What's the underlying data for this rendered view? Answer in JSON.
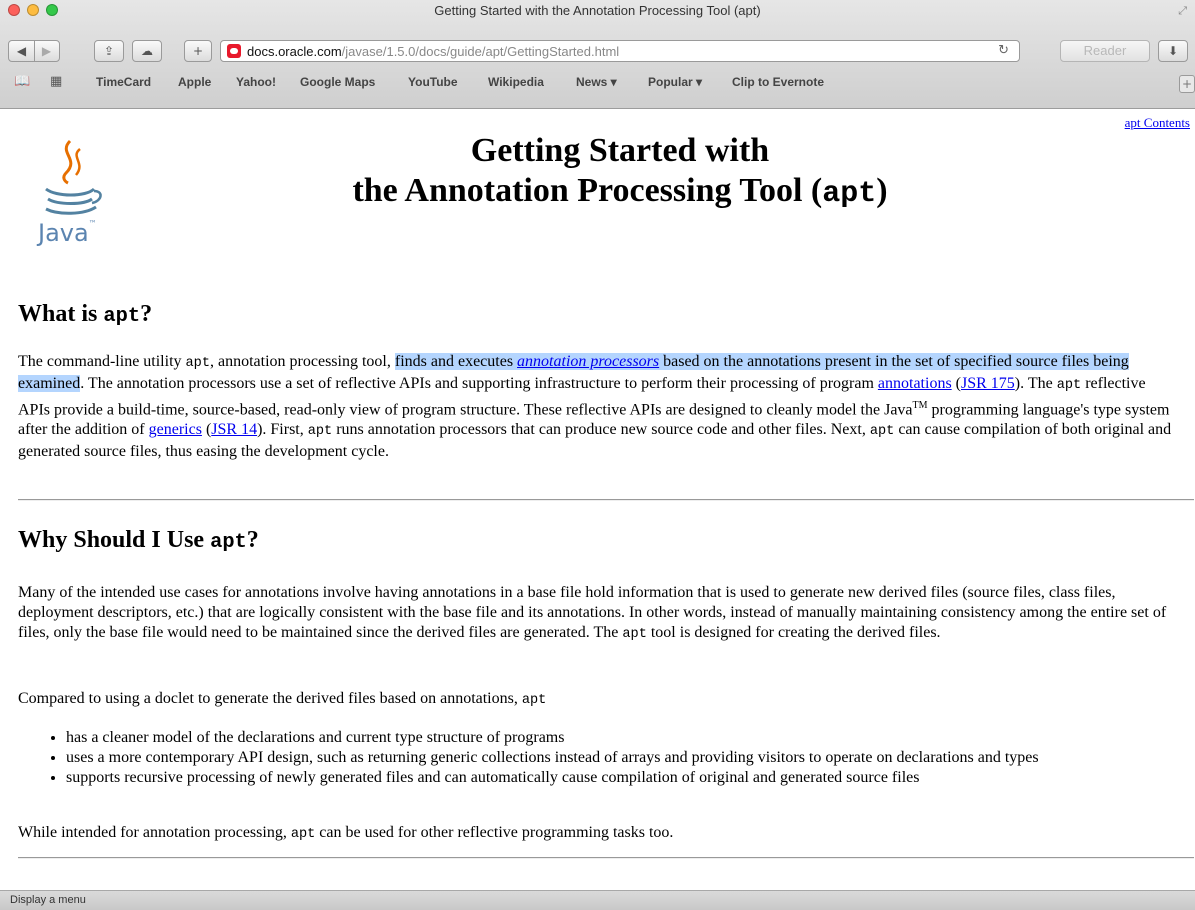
{
  "window": {
    "title": "Getting Started with the Annotation Processing Tool (apt)"
  },
  "toolbar": {
    "url_host": "docs.oracle.com",
    "url_path": "/javase/1.5.0/docs/guide/apt/GettingStarted.html",
    "reader_label": "Reader"
  },
  "bookmarks": [
    {
      "label": "TimeCard"
    },
    {
      "label": "Apple"
    },
    {
      "label": "Yahoo!"
    },
    {
      "label": "Google Maps"
    },
    {
      "label": "YouTube"
    },
    {
      "label": "Wikipedia"
    },
    {
      "label": "News ▾"
    },
    {
      "label": "Popular ▾"
    },
    {
      "label": "Clip to Evernote"
    }
  ],
  "page": {
    "top_link": "apt Contents",
    "logo_text": "Java",
    "logo_tm": "™",
    "title_line1": "Getting Started with",
    "title_line2": "the Annotation Processing Tool (",
    "title_code": "apt",
    "title_close": ")",
    "s1": {
      "heading_pre": "What is ",
      "heading_code": "apt",
      "heading_post": "?",
      "p_a": "The command-line utility ",
      "p_code1": "apt",
      "p_b": ", annotation processing tool, ",
      "p_hl1": "finds and executes ",
      "p_link1": "annotation processors",
      "p_hl2": " based on the annotations present in the set of specified source files being examined",
      "p_c": ". The annotation processors use a set of reflective APIs and supporting infrastructure to perform their processing of program ",
      "p_link2": "annotations",
      "p_d": " (",
      "p_link3": "JSR 175",
      "p_e": "). The ",
      "p_code2": "apt",
      "p_f": " reflective APIs provide a build-time, source-based, read-only view of program structure. These reflective APIs are designed to cleanly model the Java",
      "p_tm": "TM",
      "p_g": " programming language's type system after the addition of ",
      "p_link4": "generics",
      "p_h": " (",
      "p_link5": "JSR 14",
      "p_i": "). First, ",
      "p_code3": "apt",
      "p_j": " runs annotation processors that can produce new source code and other files. Next, ",
      "p_code4": "apt",
      "p_k": " can cause compilation of both original and generated source files, thus easing the development cycle."
    },
    "s2": {
      "heading_pre": "Why Should I Use ",
      "heading_code": "apt",
      "heading_post": "?",
      "p1_a": "Many of the intended use cases for annotations involve having annotations in a base file hold information that is used to generate new derived files (source files, class files, deployment descriptors, etc.) that are logically consistent with the base file and its annotations. In other words, instead of manually maintaining consistency among the entire set of files, only the base file would need to be maintained since the derived files are generated. The ",
      "p1_code": "apt",
      "p1_b": " tool is designed for creating the derived files.",
      "p2_a": "Compared to using a doclet to generate the derived files based on annotations, ",
      "p2_code": "apt",
      "bullets": [
        "has a cleaner model of the declarations and current type structure of programs",
        "uses a more contemporary API design, such as returning generic collections instead of arrays and providing visitors to operate on declarations and types",
        "supports recursive processing of newly generated files and can automatically cause compilation of original and generated source files"
      ],
      "p3_a": "While intended for annotation processing, ",
      "p3_code": "apt",
      "p3_b": " can be used for other reflective programming tasks too."
    }
  },
  "status": {
    "text": "Display a menu"
  }
}
